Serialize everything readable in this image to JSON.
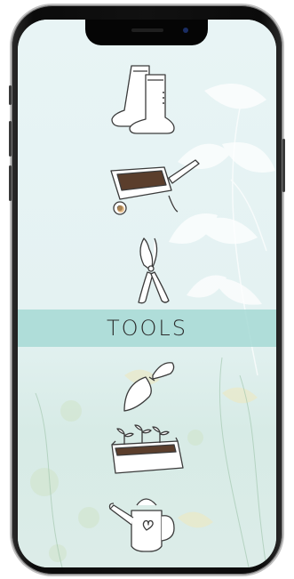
{
  "screen": {
    "title": "TOOLS",
    "background_color": "#eaf5f6",
    "band_color": "#a6d9d5",
    "items": [
      {
        "name": "boots",
        "icon": "rain-boots-icon"
      },
      {
        "name": "wheelbarrow",
        "icon": "wheelbarrow-icon"
      },
      {
        "name": "pruner",
        "icon": "pruning-shears-icon"
      },
      {
        "name": "trowel",
        "icon": "trowel-icon"
      },
      {
        "name": "seedling-planter",
        "icon": "seedling-planter-icon"
      },
      {
        "name": "watering-can",
        "icon": "watering-can-icon"
      }
    ]
  }
}
